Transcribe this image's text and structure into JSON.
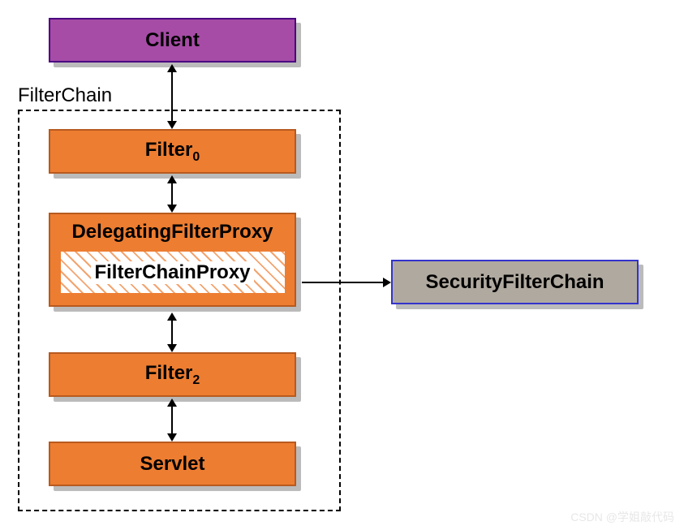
{
  "client": {
    "label": "Client"
  },
  "chain": {
    "label": "FilterChain"
  },
  "filter0": {
    "label": "Filter",
    "sub": "0"
  },
  "dfp": {
    "label": "DelegatingFilterProxy"
  },
  "fcp": {
    "label": "FilterChainProxy"
  },
  "filter2": {
    "label": "Filter",
    "sub": "2"
  },
  "servlet": {
    "label": "Servlet"
  },
  "sfc": {
    "label": "SecurityFilterChain"
  },
  "watermark": "CSDN @学姐敲代码"
}
